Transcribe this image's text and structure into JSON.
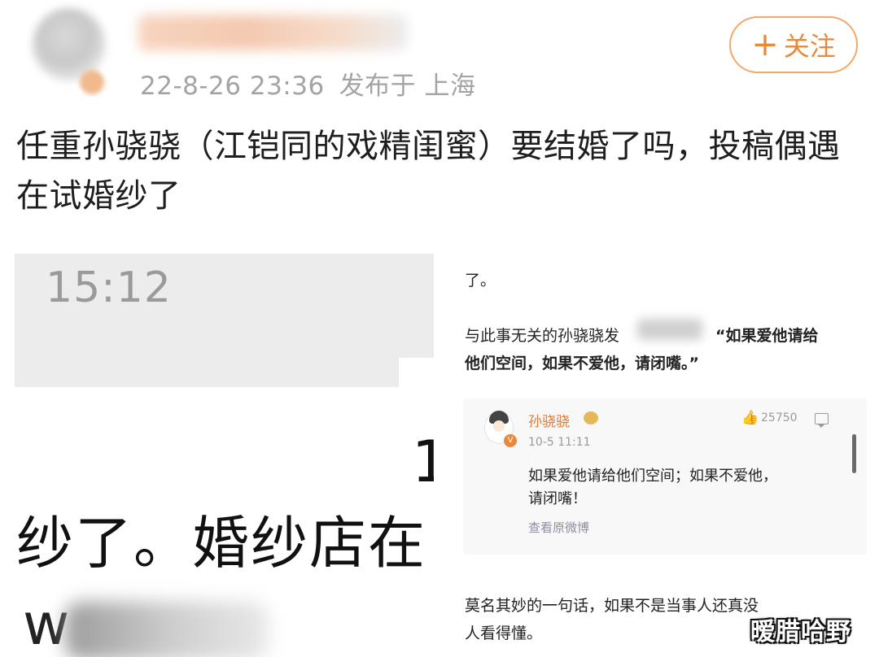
{
  "post": {
    "date": "22-8-26 23:36",
    "location_text": "发布于 上海",
    "follow_label": "关注",
    "follow_plus": "+",
    "text": "任重孙骁骁（江铠同的戏精闺蜜）要结婚了吗，投稿偶遇在试婚纱了"
  },
  "left_screenshot": {
    "time": "15:12",
    "fragment_one": "1",
    "fragment_line": "纱了。婚纱店在",
    "fragment_w": "w"
  },
  "right_screenshot": {
    "line1": "了。",
    "line2_prefix": "与此事无关的孙骁骁",
    "line2_partial": "发",
    "line2_quote_start": "“如果爱他请给",
    "line3": "他们空间，如果不爱他，请闭嘴。”",
    "card": {
      "name": "孙骁骁",
      "date": "10-5 11:11",
      "likes": "25750",
      "body_line1": "如果爱他请给他们空间；如果不爱他，",
      "body_line2": "请闭嘴！",
      "link": "查看原微博"
    },
    "footer_line1": "莫名其妙的一句话，如果不是当事人还真没",
    "footer_line2": "人看得懂。"
  },
  "watermark": "暧腊哈野",
  "colors": {
    "accent_orange": "#e8893b",
    "follow_border": "#f0a96a",
    "meta_gray": "#a4a4a4"
  },
  "icons": {
    "like": "thumbs-up-icon",
    "comment": "comment-icon",
    "verified": "verified-badge-icon"
  }
}
